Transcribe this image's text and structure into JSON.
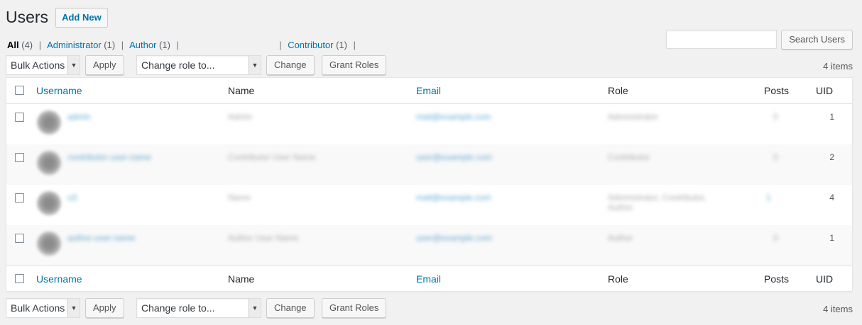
{
  "header": {
    "title": "Users",
    "add_new": "Add New"
  },
  "views": {
    "all": {
      "label": "All",
      "count": "(4)"
    },
    "administrator": {
      "label": "Administrator",
      "count": "(1)"
    },
    "author": {
      "label": "Author",
      "count": "(1)"
    },
    "contributor": {
      "label": "Contributor",
      "count": "(1)"
    },
    "separator": "|"
  },
  "search": {
    "button": "Search Users",
    "value": ""
  },
  "tablenav": {
    "bulk_actions": "Bulk Actions",
    "apply": "Apply",
    "change_role": "Change role to...",
    "change": "Change",
    "grant_roles": "Grant Roles",
    "items_count": "4 items"
  },
  "columns": {
    "username": "Username",
    "name": "Name",
    "email": "Email",
    "role": "Role",
    "posts": "Posts",
    "uid": "UID"
  },
  "rows": [
    {
      "username": "admin",
      "name": "Admin",
      "email": "mail@example.com",
      "role": "Administrator",
      "posts": "0",
      "uid": "1"
    },
    {
      "username": "contributor-user-name",
      "name": "Contributor User Name",
      "email": "user@example.com",
      "role": "Contributor",
      "posts": "0",
      "uid": "2"
    },
    {
      "username": "u3",
      "name": "Name",
      "email": "mail@example.com",
      "role": "Administrator, Contributor, Author",
      "posts": "1",
      "uid": "4"
    },
    {
      "username": "author-user-name",
      "name": "Author User Name",
      "email": "user@example.com",
      "role": "Author",
      "posts": "0",
      "uid": "1"
    }
  ]
}
